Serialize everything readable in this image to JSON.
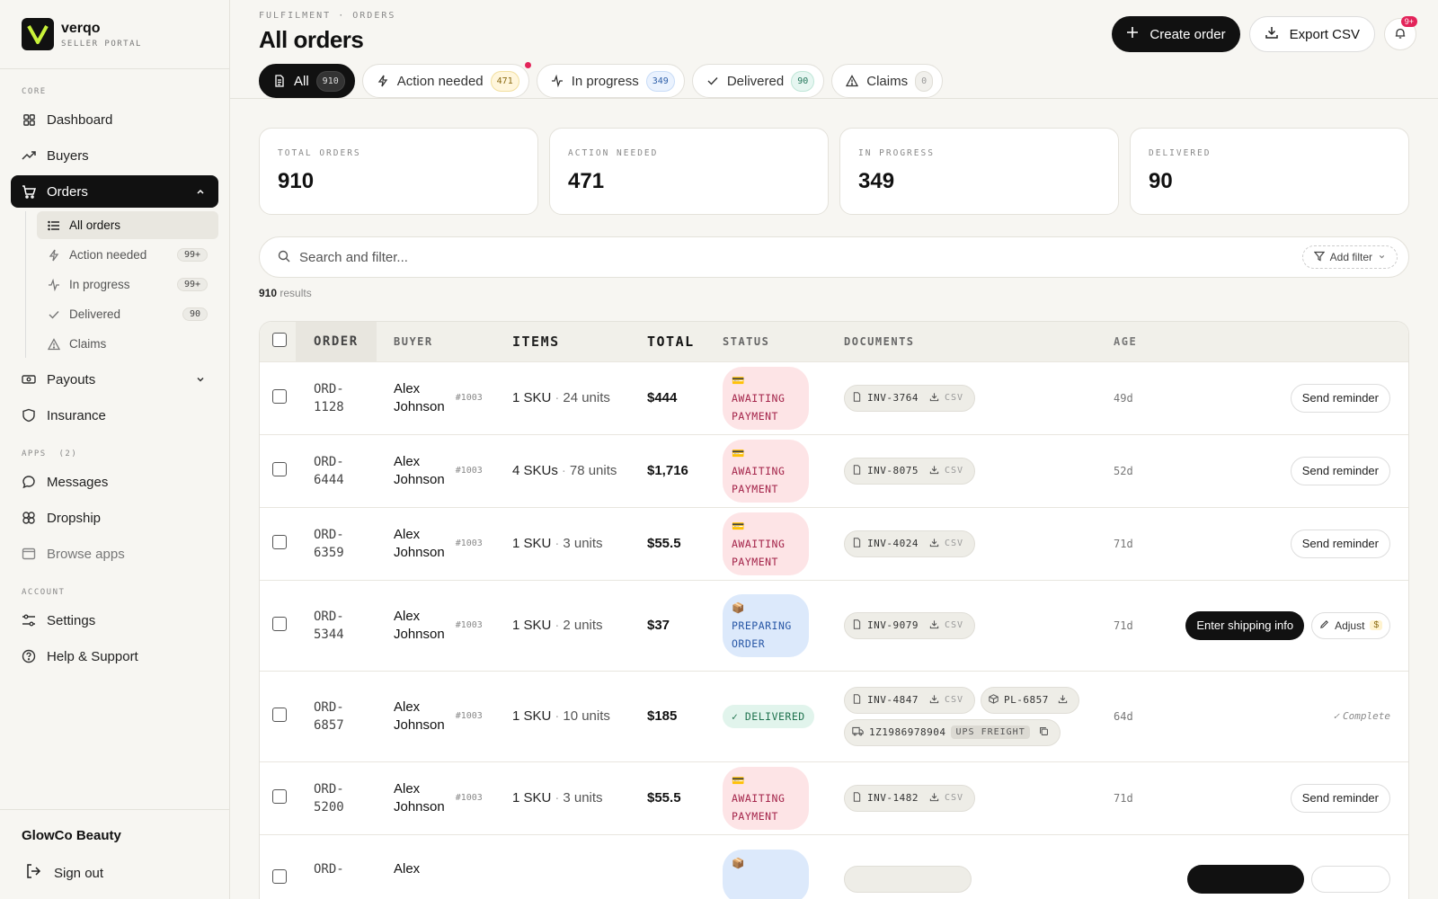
{
  "brand": {
    "name": "verqo",
    "subtitle": "SELLER PORTAL"
  },
  "sidebar": {
    "section_core": "CORE",
    "dashboard": "Dashboard",
    "buyers": "Buyers",
    "orders": "Orders",
    "sub": [
      {
        "label": "All orders",
        "count": ""
      },
      {
        "label": "Action needed",
        "count": "99+"
      },
      {
        "label": "In progress",
        "count": "99+"
      },
      {
        "label": "Delivered",
        "count": "90"
      },
      {
        "label": "Claims",
        "count": ""
      }
    ],
    "payouts": "Payouts",
    "insurance": "Insurance",
    "section_apps": "APPS  (2)",
    "messages": "Messages",
    "dropship": "Dropship",
    "browse_apps": "Browse apps",
    "section_account": "ACCOUNT",
    "settings": "Settings",
    "help": "Help & Support",
    "org": "GlowCo Beauty",
    "signout": "Sign out"
  },
  "header": {
    "breadcrumb": "FULFILMENT · ORDERS",
    "title": "All orders",
    "create_label": "Create order",
    "export_label": "Export CSV",
    "notif_count": "9+"
  },
  "tabs": [
    {
      "label": "All",
      "count": "910"
    },
    {
      "label": "Action needed",
      "count": "471"
    },
    {
      "label": "In progress",
      "count": "349"
    },
    {
      "label": "Delivered",
      "count": "90"
    },
    {
      "label": "Claims",
      "count": "0"
    }
  ],
  "stats": [
    {
      "label": "TOTAL ORDERS",
      "value": "910"
    },
    {
      "label": "ACTION NEEDED",
      "value": "471"
    },
    {
      "label": "IN PROGRESS",
      "value": "349"
    },
    {
      "label": "DELIVERED",
      "value": "90"
    }
  ],
  "search": {
    "placeholder": "Search and filter...",
    "add_filter": "Add filter"
  },
  "results": {
    "count": "910",
    "label": "results"
  },
  "table": {
    "headers": {
      "order": "ORDER",
      "buyer": "BUYER",
      "items": "ITEMS",
      "total": "TOTAL",
      "status": "STATUS",
      "documents": "DOCUMENTS",
      "age": "AGE"
    },
    "rows": [
      {
        "order1": "ORD-",
        "order2": "1128",
        "buyer1": "Alex",
        "buyer2": "Johnson",
        "buyer_id": "#1003",
        "skus": "1 SKU",
        "units": "24 units",
        "total": "$444",
        "status_icon": "💳",
        "status": "AWAITING PAYMENT",
        "inv": "INV-3764",
        "csv": "CSV",
        "age": "49d",
        "action": "Send reminder"
      },
      {
        "order1": "ORD-",
        "order2": "6444",
        "buyer1": "Alex",
        "buyer2": "Johnson",
        "buyer_id": "#1003",
        "skus": "4 SKUs",
        "units": "78 units",
        "total": "$1,716",
        "status_icon": "💳",
        "status": "AWAITING PAYMENT",
        "inv": "INV-8075",
        "csv": "CSV",
        "age": "52d",
        "action": "Send reminder"
      },
      {
        "order1": "ORD-",
        "order2": "6359",
        "buyer1": "Alex",
        "buyer2": "Johnson",
        "buyer_id": "#1003",
        "skus": "1 SKU",
        "units": "3 units",
        "total": "$55.5",
        "status_icon": "💳",
        "status": "AWAITING PAYMENT",
        "inv": "INV-4024",
        "csv": "CSV",
        "age": "71d",
        "action": "Send reminder"
      },
      {
        "order1": "ORD-",
        "order2": "5344",
        "buyer1": "Alex",
        "buyer2": "Johnson",
        "buyer_id": "#1003",
        "skus": "1 SKU",
        "units": "2 units",
        "total": "$37",
        "status_icon": "📦",
        "status": "PREPARING ORDER",
        "inv": "INV-9079",
        "csv": "CSV",
        "age": "71d",
        "action": "Enter shipping info",
        "adjust": "Adjust",
        "adjust_badge": "$"
      },
      {
        "order1": "ORD-",
        "order2": "6857",
        "buyer1": "Alex",
        "buyer2": "Johnson",
        "buyer_id": "#1003",
        "skus": "1 SKU",
        "units": "10 units",
        "total": "$185",
        "status_icon": "✓",
        "status": "DELIVERED",
        "inv": "INV-4847",
        "csv": "CSV",
        "pl": "PL-6857",
        "tracking": "1Z1986978904",
        "carrier": "UPS FREIGHT",
        "age": "64d",
        "complete": "Complete"
      },
      {
        "order1": "ORD-",
        "order2": "5200",
        "buyer1": "Alex",
        "buyer2": "Johnson",
        "buyer_id": "#1003",
        "skus": "1 SKU",
        "units": "3 units",
        "total": "$55.5",
        "status_icon": "💳",
        "status": "AWAITING PAYMENT",
        "inv": "INV-1482",
        "csv": "CSV",
        "age": "71d",
        "action": "Send reminder"
      },
      {
        "order1": "ORD-",
        "order2": "",
        "buyer1": "Alex",
        "buyer2": "",
        "buyer_id": "",
        "skus": "",
        "units": "",
        "total": "",
        "status_icon": "📦",
        "status": "",
        "inv": "",
        "csv": "",
        "age": "",
        "action": ""
      }
    ]
  }
}
